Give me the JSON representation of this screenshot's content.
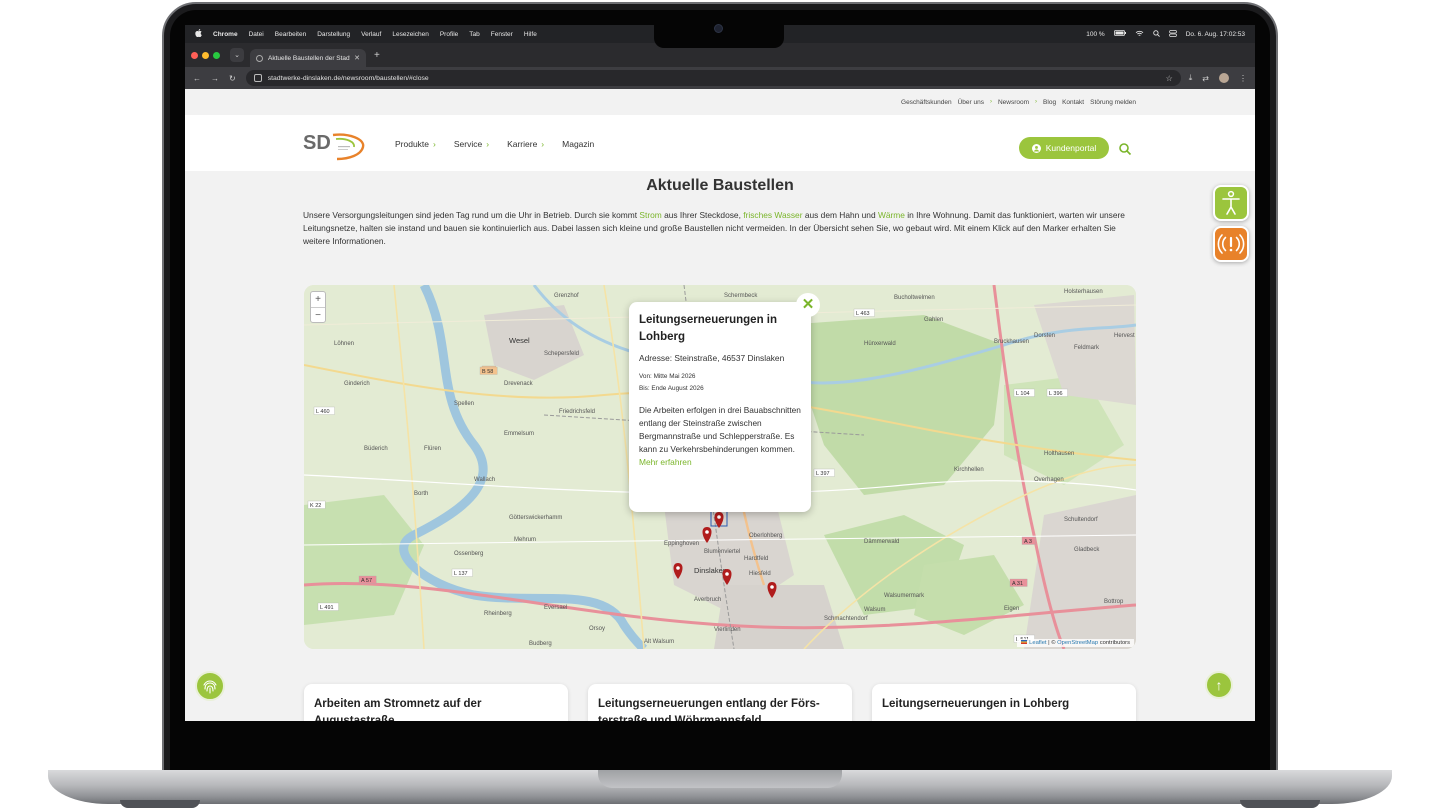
{
  "menubar": {
    "app": "Chrome",
    "items": [
      "Datei",
      "Bearbeiten",
      "Darstellung",
      "Verlauf",
      "Lesezeichen",
      "Profile",
      "Tab",
      "Fenster",
      "Hilfe"
    ],
    "battery": "100 %",
    "clock": "Do. 6. Aug.  17:02:53"
  },
  "browser": {
    "tab_title": "Aktuelle Baustellen der Stadt",
    "url": "stadtwerke-dinslaken.de/newsroom/baustellen/#close"
  },
  "site": {
    "topnav": [
      "Geschäftskunden",
      "Über uns",
      "Newsroom",
      "Blog",
      "Kontakt",
      "Störung melden"
    ],
    "nav": [
      "Produkte",
      "Service",
      "Karriere",
      "Magazin"
    ],
    "kundenportal": "Kundenportal",
    "title": "Aktuelle Baustellen",
    "intro": {
      "p1": "Unsere Versorgungsleitungen sind jeden Tag rund um die Uhr in Betrieb. Durch sie kommt ",
      "strom": "Strom",
      "p2": " aus Ihrer Steckdose, ",
      "wasser": "frisches Wasser",
      "p3": " aus dem Hahn und ",
      "waerme": "Wärme",
      "p4": " in Ihre Wohnung. Damit das funktioniert, warten wir unsere Leitungsnetze, halten sie instand und bauen sie kontinuierlich aus. Dabei lassen sich kleine und große Baustellen nicht vermeiden. In der Übersicht sehen Sie, wo gebaut wird. Mit einem Klick auf den Marker erhalten Sie weitere Informationen."
    }
  },
  "map": {
    "attribution_leaflet": "Leaflet",
    "attribution_sep": " | © ",
    "attribution_osm": "OpenStreetMap",
    "attribution_rest": " contributors",
    "places": [
      "Wesel",
      "Voerde",
      "Dinslaken",
      "Hünxe",
      "Dorsten",
      "Gladbeck",
      "Kirchhellen",
      "Rheinberg",
      "Walsum",
      "Mehrum",
      "Schermbeck",
      "Holsterhausen",
      "Bruckhausen",
      "Eppinghoven",
      "Götterswickerhamm",
      "Feldmark",
      "Bottrop",
      "Gahlen",
      "Overhagen",
      "Ossenberg",
      "Eversael",
      "Averbruch",
      "Oberlohberg",
      "Walsumermark",
      "Vierlinden",
      "Alt Walsum",
      "Schmachtendorf",
      "Orsoy",
      "Budberg",
      "Eigen",
      "Hiesfeld",
      "Dämmerwald",
      "Hervest",
      "Borth",
      "Wallach",
      "Friedrichsfeld",
      "Flüren",
      "Büderich",
      "Ginderich",
      "Schepersfeld",
      "Grenzhof",
      "Blumenviertel",
      "Hardtfeld",
      "Schultendorf",
      "Holthausen",
      "Hünxerwald",
      "Bucholtwelmen",
      "Drevenack",
      "Emmelsum",
      "Spellen",
      "Löhnen"
    ],
    "roads": [
      "A 3",
      "A 31",
      "A 57",
      "B 8",
      "B 58",
      "B 224",
      "L 463",
      "L 397",
      "L 491",
      "L 460",
      "L 511",
      "L 137",
      "L 104",
      "L 396",
      "K 22"
    ],
    "popup": {
      "title": "Leitungserneuerungen in Lohberg",
      "address": "Adresse: Steinstraße, 46537 Dinslaken",
      "from": "Von: Mitte Mai 2026",
      "to": "Bis: Ende August 2026",
      "description": "Die Arbeiten erfolgen in drei Bauabschnitten entlang der Steinstraße zwischen Bergmannstraße und Schlepperstraße. Es kann zu Verkehrsbehinderungen kommen.",
      "more": "Mehr erfahren"
    },
    "marker_color": "#b01c1c"
  },
  "cards": [
    {
      "title": "Arbeiten am Stromnetz auf der Augustastraße"
    },
    {
      "title": "Leitungserneuerungen entlang der Förs-terstraße und Wöhrmannsfeld"
    },
    {
      "title": "Leitungserneuerungen in Lohberg"
    }
  ],
  "colors": {
    "accent": "#9bc53d",
    "alert": "#e8822a"
  }
}
